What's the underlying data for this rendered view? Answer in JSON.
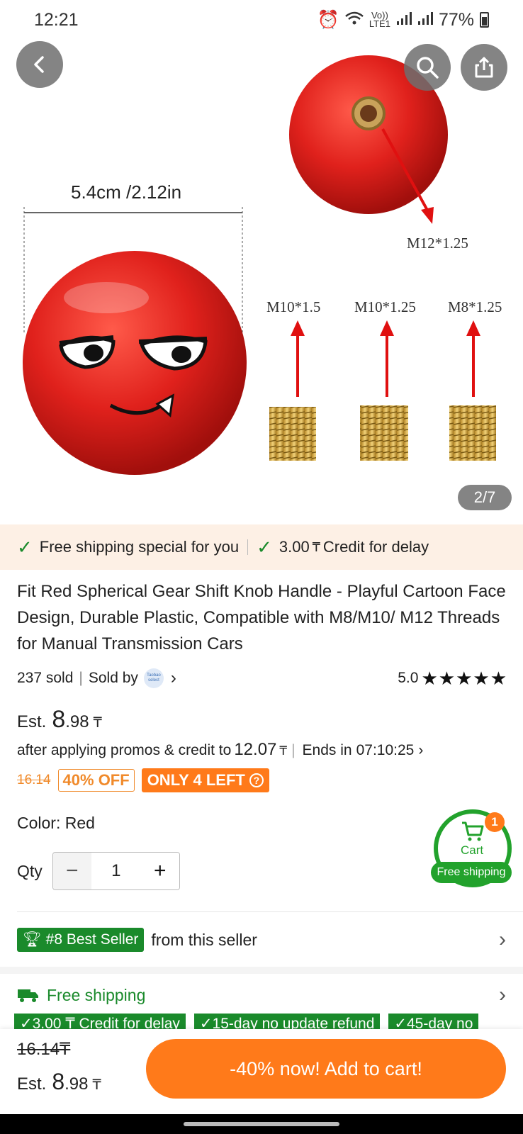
{
  "status": {
    "time": "12:21",
    "network": "LTE1",
    "volte": "Vo))",
    "battery": "77%"
  },
  "gallery": {
    "dimension_label": "5.4cm /2.12in",
    "thread_top": "M12*1.25",
    "threads": [
      "M10*1.5",
      "M10*1.25",
      "M8*1.25"
    ],
    "page_indicator": "2/7"
  },
  "shipping_banner": {
    "left": "Free shipping special for you",
    "right_amount": "3.00",
    "right_text": "Credit for delay",
    "currency": "₸"
  },
  "product": {
    "title": "Fit Red Spherical Gear Shift Knob Handle - Playful Cartoon Face Design, Durable Plastic, Compatible with M8/M10/ M12 Threads for Manual Transmission Cars",
    "sold": "237 sold",
    "sold_by": "Sold by",
    "store_logo_text": "Taobao select",
    "rating": "5.0",
    "stars": "★★★★★",
    "est_label": "Est.",
    "est_int": "8",
    "est_dec": ".98",
    "currency": "₸",
    "promo_text": "after applying promos & credit to",
    "promo_price": "12.07",
    "ends_label": "Ends in",
    "countdown": "07:10:25",
    "original_price": "16.14",
    "discount_badge": "40% OFF",
    "stock_badge": "ONLY 4 LEFT",
    "color_label": "Color: Red",
    "qty_label": "Qty",
    "qty_value": "1"
  },
  "cart": {
    "label": "Cart",
    "count": "1",
    "free_label": "Free shipping"
  },
  "seller": {
    "badge": "#8 Best Seller",
    "text": "from this seller"
  },
  "shipping": {
    "title": "Free shipping",
    "chips": [
      "3.00 ₸ Credit for delay",
      "15-day no update refund",
      "45-day no"
    ]
  },
  "bottom": {
    "old_price": "16.14₸",
    "est_label": "Est.",
    "est_int": "8",
    "est_dec": ".98",
    "currency": "₸",
    "button": "-40% now! Add to cart!"
  },
  "colors": {
    "accent": "#ff7a1a",
    "green": "#1a8a2b",
    "knob_red": "#e0211c"
  }
}
